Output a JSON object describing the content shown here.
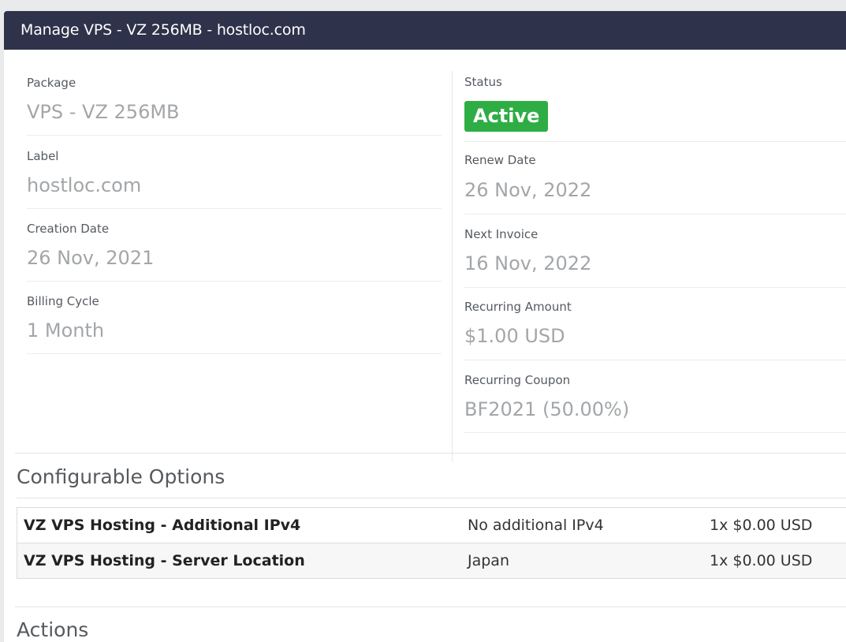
{
  "header": {
    "title": "Manage VPS - VZ 256MB - hostloc.com"
  },
  "details": {
    "left": [
      {
        "label": "Package",
        "value": "VPS - VZ 256MB"
      },
      {
        "label": "Label",
        "value": "hostloc.com"
      },
      {
        "label": "Creation Date",
        "value": "26 Nov, 2021"
      },
      {
        "label": "Billing Cycle",
        "value": "1 Month"
      }
    ],
    "status": {
      "label": "Status",
      "value": "Active",
      "color": "#2fad45"
    },
    "right": [
      {
        "label": "Renew Date",
        "value": "26 Nov, 2022"
      },
      {
        "label": "Next Invoice",
        "value": "16 Nov, 2022"
      },
      {
        "label": "Recurring Amount",
        "value": "$1.00 USD"
      },
      {
        "label": "Recurring Coupon",
        "value": "BF2021 (50.00%)"
      }
    ]
  },
  "configurable_options": {
    "title": "Configurable Options",
    "rows": [
      {
        "name": "VZ VPS Hosting - Additional IPv4",
        "value": "No additional IPv4",
        "price": "1x $0.00 USD"
      },
      {
        "name": "VZ VPS Hosting - Server Location",
        "value": "Japan",
        "price": "1x $0.00 USD"
      }
    ]
  },
  "actions": {
    "title": "Actions"
  },
  "colors": {
    "header_bg": "#2e324a",
    "active_badge": "#2fad45"
  }
}
